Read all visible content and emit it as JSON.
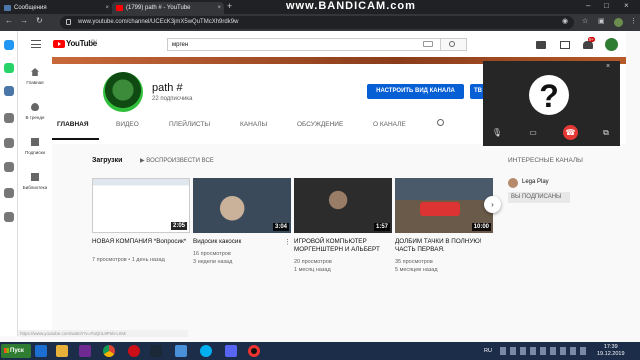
{
  "browser": {
    "tabs": [
      {
        "label": "Сообщения",
        "fav_color": "#4a76a8"
      },
      {
        "label": "(1799) path # - YouTube",
        "fav_color": "#ff0000"
      }
    ],
    "close_glyph": "×",
    "new_tab_glyph": "+",
    "watermark": "www.BANDICAM.com",
    "url": "www.youtube.com/channel/UCEcK3jmX5wQuTMcXh9rdk9w"
  },
  "youtube": {
    "logo_text": "YouTube",
    "logo_region": "RU",
    "search_value": "мрген",
    "notifications_badge": "9+",
    "sidebar": [
      {
        "label": "Главная",
        "icon": "home-icon"
      },
      {
        "label": "В тренде",
        "icon": "fire-icon"
      },
      {
        "label": "Подписки",
        "icon": "subscriptions-icon"
      },
      {
        "label": "Библиотека",
        "icon": "library-icon"
      }
    ],
    "channel": {
      "name": "path #",
      "subscribers": "22 подписчика",
      "customize_label": "НАСТРОИТЬ ВИД КАНАЛА",
      "studio_label": "ТВ"
    },
    "tabs": [
      "ГЛАВНАЯ",
      "ВИДЕО",
      "ПЛЕЙЛИСТЫ",
      "КАНАЛЫ",
      "ОБСУЖДЕНИЕ",
      "О КАНАЛЕ"
    ],
    "uploads": {
      "title": "Загрузки",
      "play_all": "ВОСПРОИЗВЕСТИ ВСЕ"
    },
    "videos": [
      {
        "title": "НОВАЯ КОМПАНИЯ *Вопросик*",
        "views": "7 просмотров",
        "age": "1 день назад",
        "duration": "2:05",
        "thumb_color": "#e8edf3"
      },
      {
        "title": "Видосик какосик",
        "views": "16 просмотров",
        "age": "3 недели назад",
        "duration": "3:04",
        "thumb_color": "#3a4a5a"
      },
      {
        "title": "ИГРОВОЙ КОМПЬЮТЕР МОРГЕНШТЕРН И АЛЬБЕРТ",
        "views": "20 просмотров",
        "age": "1 месяц назад",
        "duration": "1:57",
        "thumb_color": "#2c2c2c"
      },
      {
        "title": "ДОЛБИМ ТАЧКИ В ПОЛНУЮ! ЧАСТЬ ПЕРВАЯ.",
        "views": "35 просмотров",
        "age": "5 месяцев назад",
        "duration": "10:00",
        "thumb_color": "#5a4a3a"
      }
    ],
    "featured": {
      "title": "ИНТЕРЕСНЫЕ КАНАЛЫ",
      "channel_name": "Lega Play",
      "subscribed_label": "ВЫ ПОДПИСАНЫ"
    },
    "status_link": "https://www.youtube.com/watch?v=PaQnL9Peb-L0sk"
  },
  "call_overlay": {
    "avatar_glyph": "?",
    "close_glyph": "×"
  },
  "taskbar": {
    "start_label": "Пуск",
    "language": "RU",
    "time": "17:39",
    "date": "19.12.2019"
  }
}
